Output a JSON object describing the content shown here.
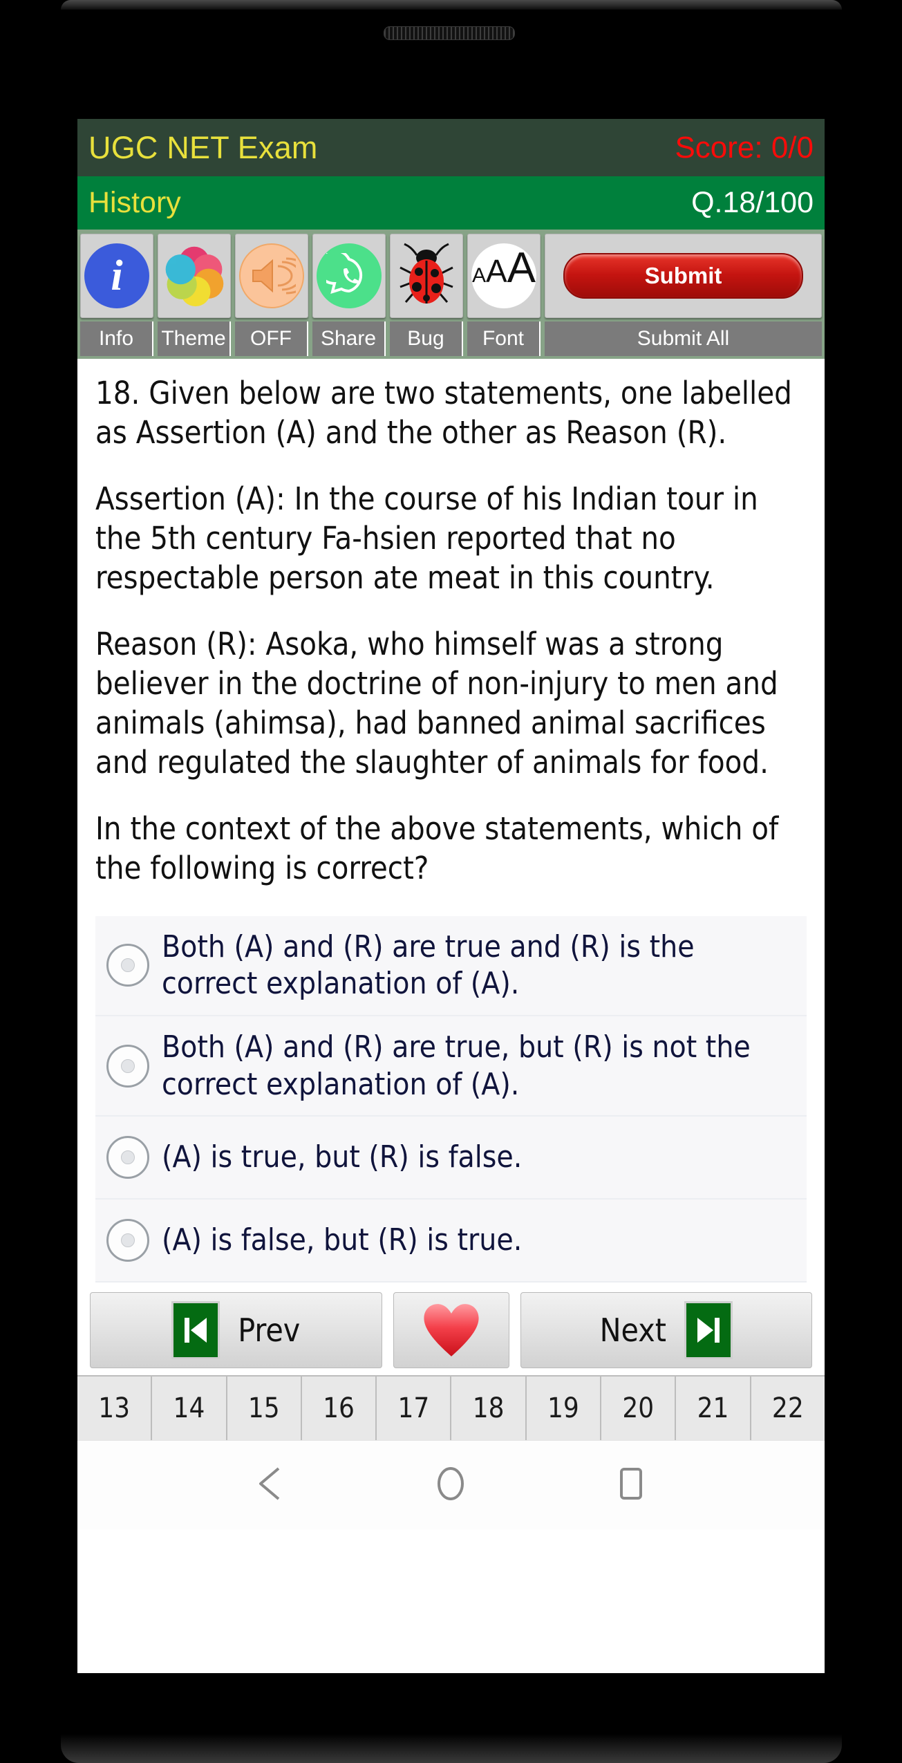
{
  "app": {
    "title": "UGC NET Exam",
    "score_label": "Score: 0/0",
    "subject": "History",
    "question_counter": "Q.18/100"
  },
  "toolbar": {
    "items": [
      {
        "label": "Info",
        "icon": "info-circle-icon"
      },
      {
        "label": "Theme",
        "icon": "color-wheel-icon"
      },
      {
        "label": "OFF",
        "icon": "speaker-sound-icon"
      },
      {
        "label": "Share",
        "icon": "whatsapp-share-icon"
      },
      {
        "label": "Bug",
        "icon": "ladybug-icon"
      },
      {
        "label": "Font",
        "icon": "font-size-icon"
      },
      {
        "label": "Submit All",
        "icon": "submit-button-icon",
        "button_label": "Submit"
      }
    ]
  },
  "question": {
    "paragraphs": [
      "18. Given below are two statements, one labelled as Assertion (A) and the other as Reason (R).",
      "Assertion (A): In the course of his Indian tour in the 5th century Fa-hsien reported that no respectable person ate meat in this country.",
      "Reason (R): Asoka, who himself was a strong believer in the doctrine of non-injury to men and animals (ahimsa), had banned animal sacrifices and regulated the slaughter of animals for food.",
      "In the context of the above statements, which of the following is correct?"
    ],
    "options": [
      "Both (A) and (R) are true and (R) is the correct explanation of (A).",
      "Both (A) and (R) are true, but (R) is not the correct explanation of (A).",
      "(A) is true, but (R) is false.",
      "(A) is false, but (R) is true."
    ],
    "selected_option": null
  },
  "navigation": {
    "prev_label": "Prev",
    "next_label": "Next",
    "favorite_icon": "heart-icon",
    "prev_icon": "skip-previous-icon",
    "next_icon": "skip-next-icon",
    "question_numbers": [
      "13",
      "14",
      "15",
      "16",
      "17",
      "18",
      "19",
      "20",
      "21",
      "22"
    ]
  },
  "android_nav": {
    "back": "back-triangle-icon",
    "home": "home-circle-icon",
    "recents": "recents-square-icon"
  },
  "colors": {
    "title_bar_bg": "#2f4536",
    "subject_bar_bg": "#00803c",
    "accent_yellow": "#e8e03c",
    "score_red": "#fb0b09",
    "toolbar_bg": "#87a387",
    "tool_label_bg": "#7b7b7b",
    "submit_red": "#c41410",
    "option_bg": "#f7f7f9",
    "option_text": "#10143c"
  }
}
